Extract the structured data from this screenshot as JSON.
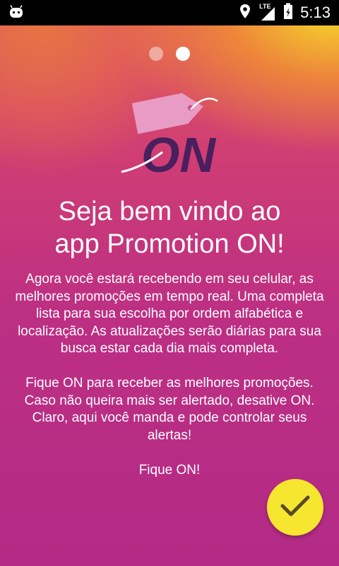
{
  "status_bar": {
    "time": "5:13",
    "network": "LTE",
    "icons": [
      "android-icon",
      "location-icon",
      "signal-icon",
      "battery-icon"
    ]
  },
  "pager": {
    "total_pages": 2,
    "current_page": 2
  },
  "logo": {
    "text": "ON",
    "icon": "price-tag-icon"
  },
  "title": {
    "line1": "Seja bem vindo ao",
    "line2": "app Promotion ON!"
  },
  "description": {
    "paragraph1": "Agora você estará recebendo em seu celular, as melhores promoções em tempo real. Uma completa lista para sua escolha por ordem alfabética e localização. As atualizações serão diárias para sua busca estar cada dia mais completa.",
    "paragraph2": "Fique ON para receber as melhores promoções. Caso não queira mais ser alertado, desative ON. Claro, aqui você manda e pode controlar seus alertas!",
    "paragraph3": "Fique ON!"
  },
  "confirm_button": {
    "icon": "check-icon",
    "color": "#f6e630"
  },
  "colors": {
    "gradient_top_right": "#f6da28",
    "gradient_mid": "#cf3d74",
    "gradient_bottom": "#b32b86",
    "logo_purple": "#4a1f5e",
    "tag_pink": "#e9a0c9"
  }
}
